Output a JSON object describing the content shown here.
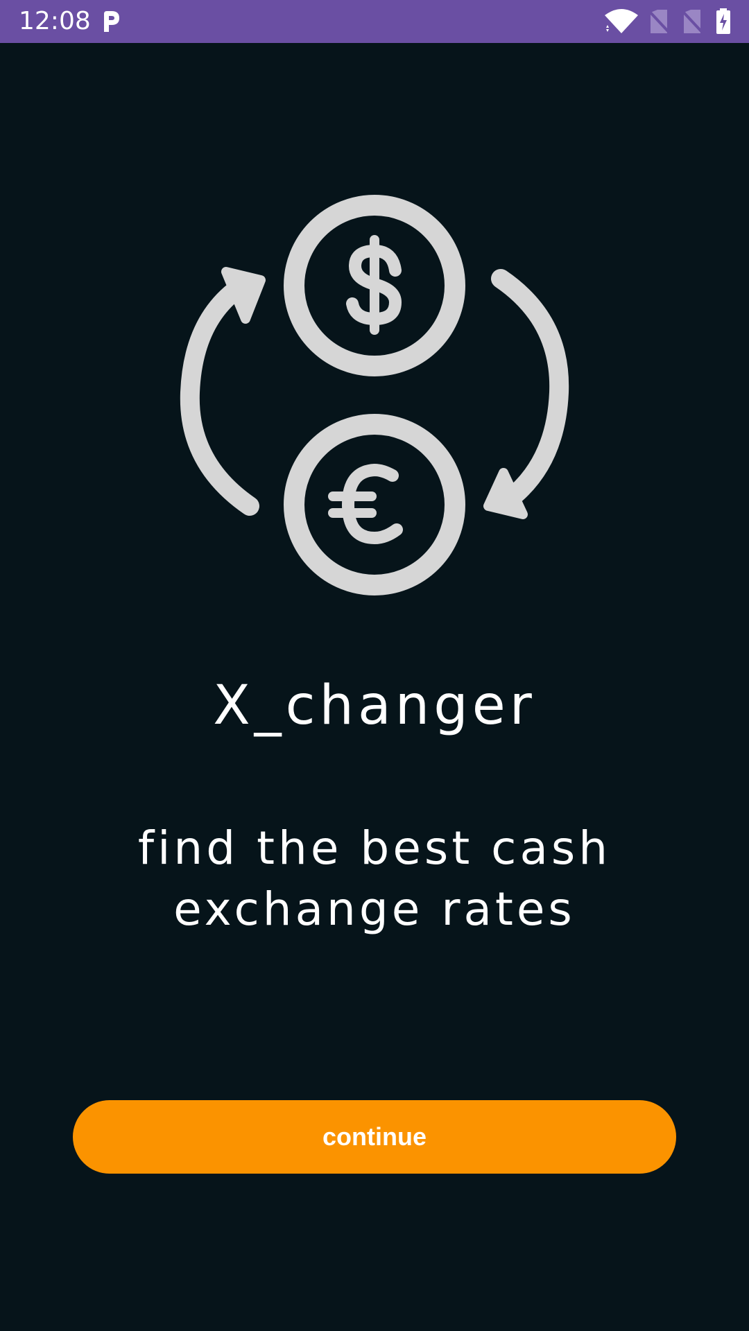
{
  "status_bar": {
    "time": "12:08",
    "background": "#6a4fa3",
    "icons": [
      "parking-icon",
      "wifi-icon",
      "no-sim-icon",
      "no-sim-icon",
      "battery-charging-icon"
    ]
  },
  "app": {
    "logo_icon": "currency-exchange-icon",
    "title": "X_changer",
    "tagline": "find the best cash exchange rates",
    "continue_label": "continue"
  },
  "colors": {
    "background": "#06141a",
    "accent": "#fb9300",
    "icon": "#d6d6d6",
    "text": "#ffffff"
  }
}
